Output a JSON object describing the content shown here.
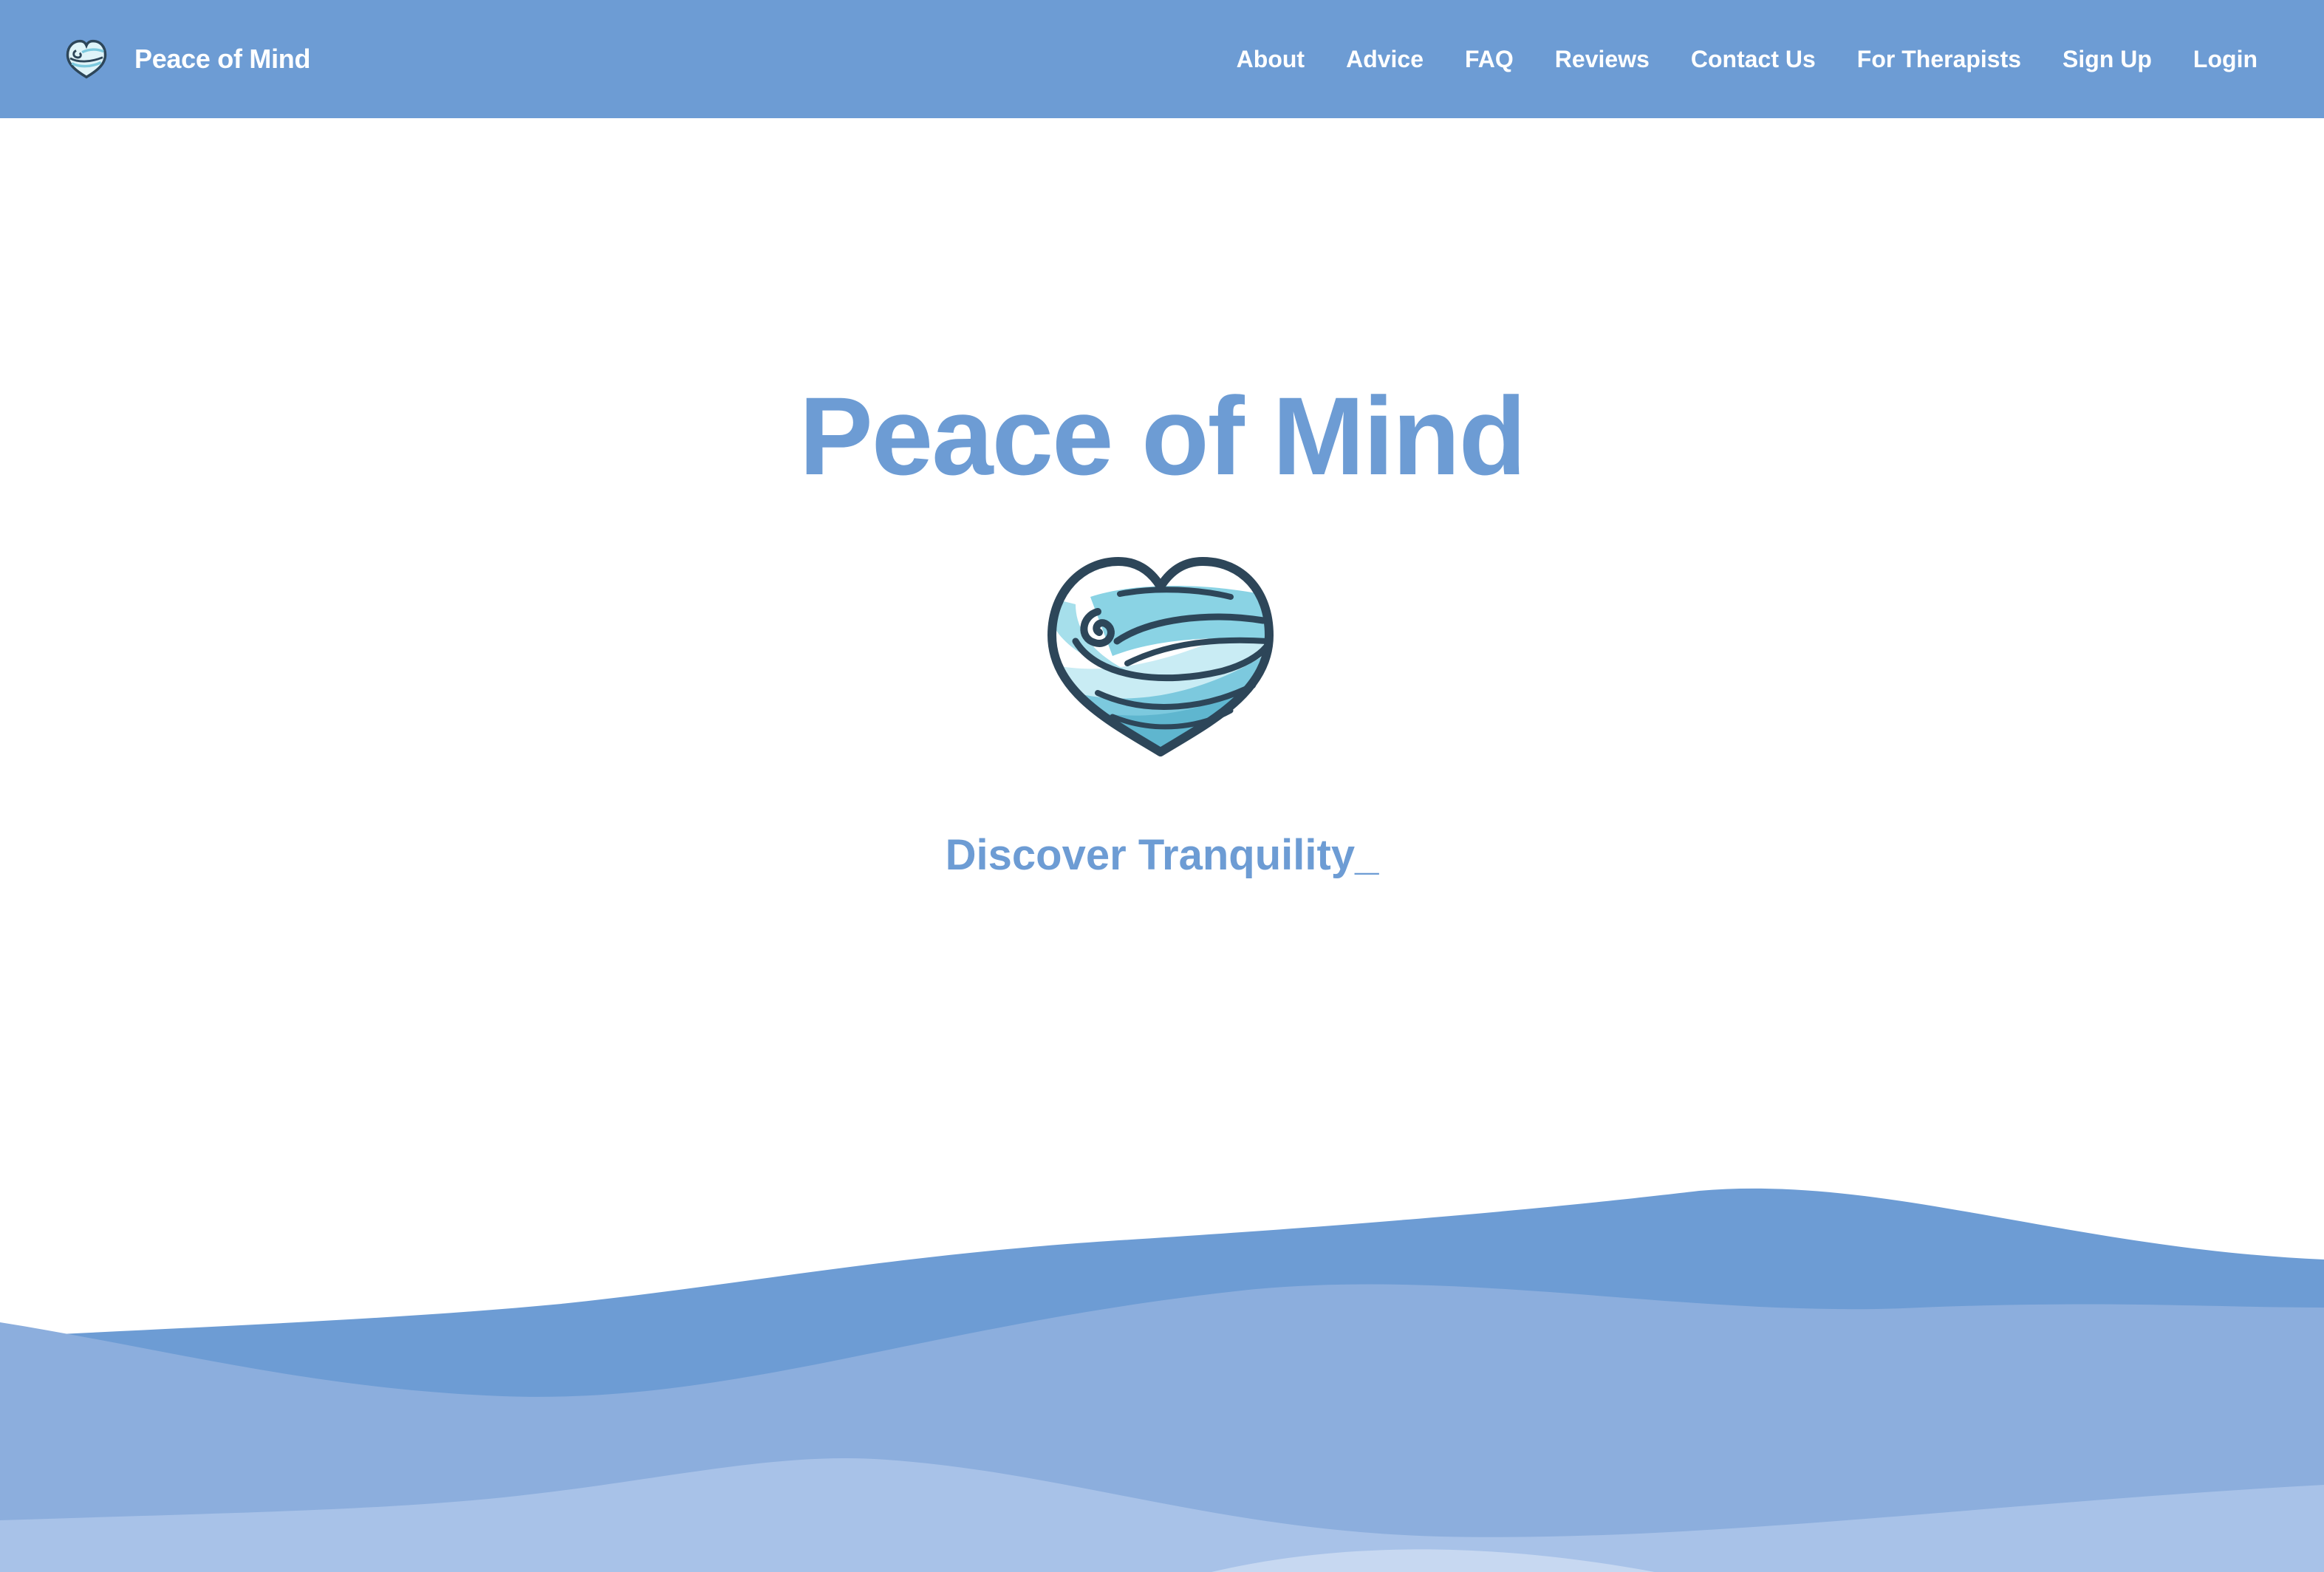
{
  "header": {
    "brand_name": "Peace of Mind",
    "nav": [
      {
        "label": "About"
      },
      {
        "label": "Advice"
      },
      {
        "label": "FAQ"
      },
      {
        "label": "Reviews"
      },
      {
        "label": "Contact Us"
      },
      {
        "label": "For Therapists"
      },
      {
        "label": "Sign Up"
      },
      {
        "label": "Login"
      }
    ]
  },
  "hero": {
    "title": "Peace of Mind",
    "tagline": "Discover Tranquility_",
    "logo_icon": "heart-wave-logo"
  },
  "colors": {
    "primary": "#6d9cd4",
    "wave_dark": "#6d9cd4",
    "wave_mid": "#8caedd",
    "wave_light": "#a8c2e8",
    "wave_lightest": "#c7d8f1",
    "logo_outline": "#2d4659",
    "logo_water": "#7cc9de"
  }
}
